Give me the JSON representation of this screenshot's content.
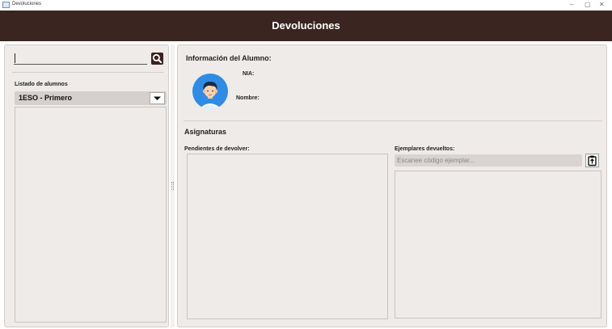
{
  "window": {
    "title": "Devoluciones",
    "minimize": "–",
    "maximize": "▢",
    "close": "✕"
  },
  "header": {
    "title": "Devoluciones"
  },
  "left": {
    "search": {
      "value": "",
      "placeholder": ""
    },
    "list_label": "Listado de alumnos",
    "course_select": {
      "selected": "1ESO - Primero"
    },
    "students": []
  },
  "right": {
    "info_title": "Información del Alumno:",
    "nia_label": "NIA:",
    "nombre_label": "Nombre:",
    "asignaturas_title": "Asignaturas",
    "pendientes_label": "Pendientes de devolver:",
    "ejemplares_label": "Ejemplares devueltos:",
    "scan_input": {
      "value": "",
      "placeholder": "Escanee código ejemplar..."
    }
  },
  "icons": {
    "search": "search-icon",
    "dropdown": "chevron-down-icon",
    "clipboard": "clipboard-icon",
    "avatar": "user-avatar-icon"
  },
  "colors": {
    "header_bg": "#3b2521",
    "panel_bg": "#efebe9",
    "accent_dark": "#3a2420",
    "avatar_blue": "#2f8ce6"
  }
}
